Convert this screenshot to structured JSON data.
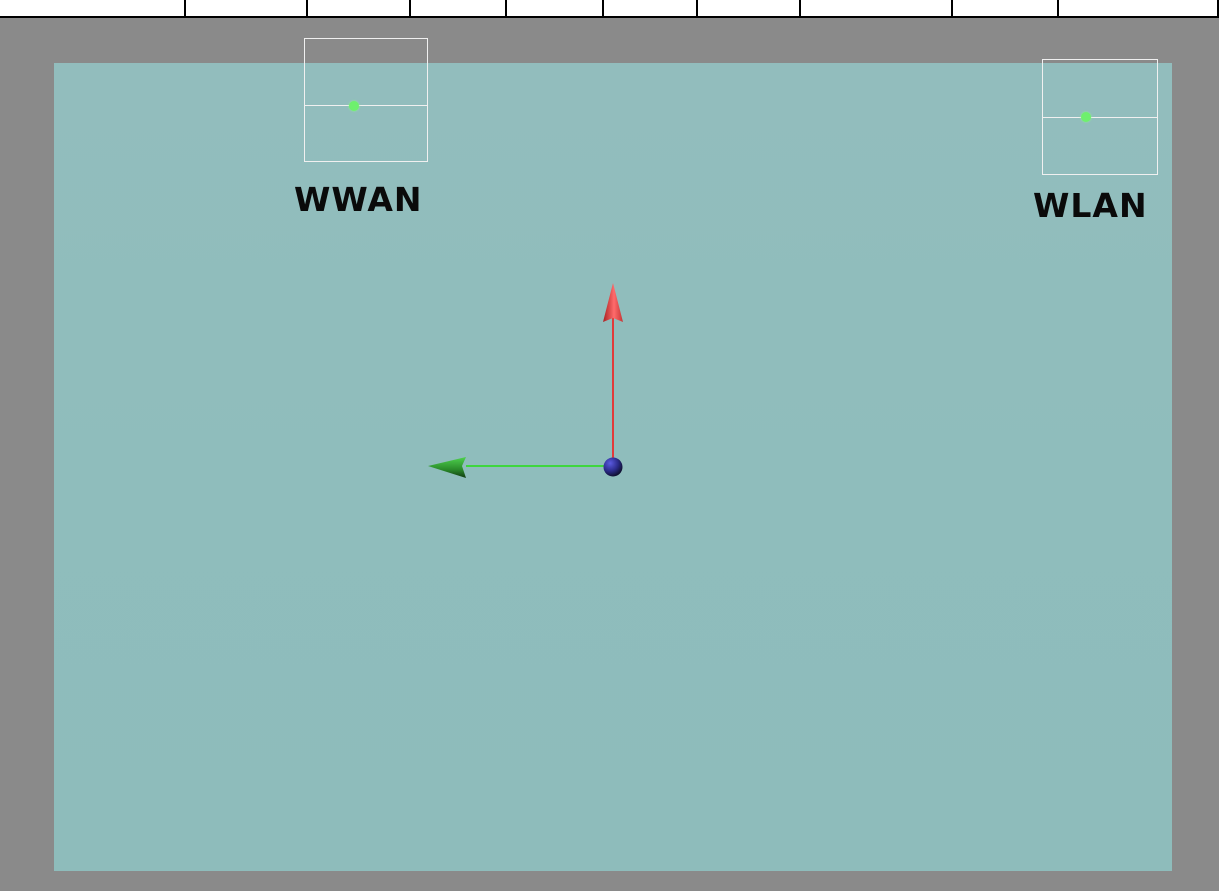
{
  "toolbar": {
    "cells": [
      "",
      "",
      "",
      "",
      "",
      "",
      "",
      "",
      "",
      "",
      ""
    ]
  },
  "viewport": {
    "colors": {
      "background": "#8a8a8a",
      "plane": "#8fbdbc",
      "y_axis": "#e23a3a",
      "x_axis": "#3ed63e",
      "origin": "#2f2f9a",
      "gizmo_dot": "#6ef06e",
      "gizmo_frame": "#f0f0f0"
    },
    "gizmos": [
      {
        "label": "WWAN",
        "icon": "wwan-gizmo-icon"
      },
      {
        "label": "WLAN",
        "icon": "wlan-gizmo-icon"
      }
    ],
    "axes": {
      "up_icon": "red-up-arrow-icon",
      "left_icon": "green-left-arrow-icon",
      "origin_icon": "blue-origin-sphere-icon"
    }
  }
}
